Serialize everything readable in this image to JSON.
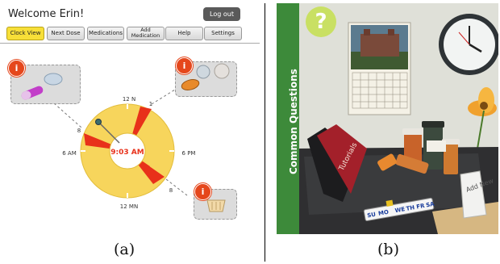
{
  "panel_a": {
    "welcome_text": "Welcome Erin!",
    "logout_label": "Log out",
    "nav_items": [
      {
        "label": "Clock View",
        "active": true
      },
      {
        "label": "Next Dose",
        "active": false
      },
      {
        "label": "Medications",
        "active": false
      },
      {
        "label": "Add Medication",
        "active": false
      },
      {
        "label": "Help",
        "active": false
      },
      {
        "label": "Settings",
        "active": false
      }
    ],
    "clock": {
      "center_time": "9:03 AM",
      "label_top": "12 N",
      "label_bottom": "12 MN",
      "label_left": "6 AM",
      "label_right": "6 PM"
    },
    "dose_hours": {
      "left": "8",
      "top_right": "1",
      "bottom_right": "8"
    },
    "info_icon_label": "i",
    "colors": {
      "ring": "#f7d55c",
      "dose_wedge": "#e8311a",
      "accent_nav": "#f7df38",
      "info": "#e5471c"
    }
  },
  "panel_b": {
    "sidebar_label": "Common Questions",
    "help_badge": "?",
    "book_title": "Tutorials",
    "pill_organizer_days": [
      "SU",
      "MO",
      "WE",
      "TH",
      "FR",
      "SA"
    ],
    "bag_label": "Add New"
  },
  "captions": {
    "a": "(a)",
    "b": "(b)"
  }
}
